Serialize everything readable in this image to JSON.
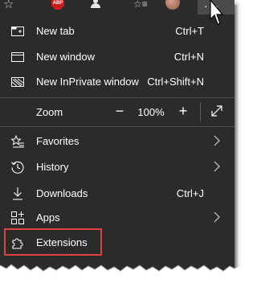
{
  "menu": {
    "items_top": [
      {
        "label": "New tab",
        "shortcut": "Ctrl+T",
        "icon": "new-tab-icon"
      },
      {
        "label": "New window",
        "shortcut": "Ctrl+N",
        "icon": "new-window-icon"
      },
      {
        "label": "New InPrivate window",
        "shortcut": "Ctrl+Shift+N",
        "icon": "inprivate-icon"
      }
    ],
    "zoom": {
      "label": "Zoom",
      "value": "100%",
      "minus": "−",
      "plus": "+"
    },
    "items_bottom": [
      {
        "label": "Favorites",
        "icon": "star-list-icon",
        "submenu": true
      },
      {
        "label": "History",
        "icon": "history-icon",
        "submenu": true
      },
      {
        "label": "Downloads",
        "shortcut": "Ctrl+J",
        "icon": "download-icon"
      },
      {
        "label": "Apps",
        "icon": "apps-icon",
        "submenu": true
      },
      {
        "label": "Extensions",
        "icon": "extensions-icon"
      }
    ]
  },
  "toolbar": {
    "abp_label": "ABP",
    "more_label": "···"
  },
  "colors": {
    "menu_bg": "#2b2b2b",
    "text": "#ffffff",
    "separator": "#4d4d4d",
    "highlight_border": "#e0403f",
    "more_button_bg": "#4a4a4a"
  }
}
